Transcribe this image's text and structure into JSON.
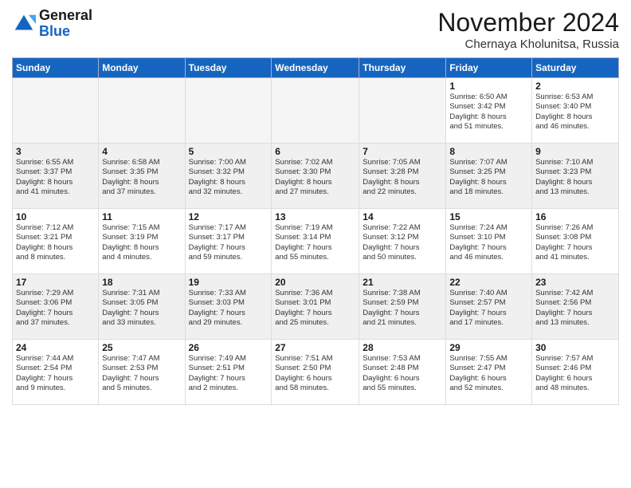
{
  "header": {
    "logo_general": "General",
    "logo_blue": "Blue",
    "month_title": "November 2024",
    "location": "Chernaya Kholunitsa, Russia"
  },
  "days_of_week": [
    "Sunday",
    "Monday",
    "Tuesday",
    "Wednesday",
    "Thursday",
    "Friday",
    "Saturday"
  ],
  "weeks": [
    [
      {
        "day": "",
        "info": ""
      },
      {
        "day": "",
        "info": ""
      },
      {
        "day": "",
        "info": ""
      },
      {
        "day": "",
        "info": ""
      },
      {
        "day": "",
        "info": ""
      },
      {
        "day": "1",
        "info": "Sunrise: 6:50 AM\nSunset: 3:42 PM\nDaylight: 8 hours\nand 51 minutes."
      },
      {
        "day": "2",
        "info": "Sunrise: 6:53 AM\nSunset: 3:40 PM\nDaylight: 8 hours\nand 46 minutes."
      }
    ],
    [
      {
        "day": "3",
        "info": "Sunrise: 6:55 AM\nSunset: 3:37 PM\nDaylight: 8 hours\nand 41 minutes."
      },
      {
        "day": "4",
        "info": "Sunrise: 6:58 AM\nSunset: 3:35 PM\nDaylight: 8 hours\nand 37 minutes."
      },
      {
        "day": "5",
        "info": "Sunrise: 7:00 AM\nSunset: 3:32 PM\nDaylight: 8 hours\nand 32 minutes."
      },
      {
        "day": "6",
        "info": "Sunrise: 7:02 AM\nSunset: 3:30 PM\nDaylight: 8 hours\nand 27 minutes."
      },
      {
        "day": "7",
        "info": "Sunrise: 7:05 AM\nSunset: 3:28 PM\nDaylight: 8 hours\nand 22 minutes."
      },
      {
        "day": "8",
        "info": "Sunrise: 7:07 AM\nSunset: 3:25 PM\nDaylight: 8 hours\nand 18 minutes."
      },
      {
        "day": "9",
        "info": "Sunrise: 7:10 AM\nSunset: 3:23 PM\nDaylight: 8 hours\nand 13 minutes."
      }
    ],
    [
      {
        "day": "10",
        "info": "Sunrise: 7:12 AM\nSunset: 3:21 PM\nDaylight: 8 hours\nand 8 minutes."
      },
      {
        "day": "11",
        "info": "Sunrise: 7:15 AM\nSunset: 3:19 PM\nDaylight: 8 hours\nand 4 minutes."
      },
      {
        "day": "12",
        "info": "Sunrise: 7:17 AM\nSunset: 3:17 PM\nDaylight: 7 hours\nand 59 minutes."
      },
      {
        "day": "13",
        "info": "Sunrise: 7:19 AM\nSunset: 3:14 PM\nDaylight: 7 hours\nand 55 minutes."
      },
      {
        "day": "14",
        "info": "Sunrise: 7:22 AM\nSunset: 3:12 PM\nDaylight: 7 hours\nand 50 minutes."
      },
      {
        "day": "15",
        "info": "Sunrise: 7:24 AM\nSunset: 3:10 PM\nDaylight: 7 hours\nand 46 minutes."
      },
      {
        "day": "16",
        "info": "Sunrise: 7:26 AM\nSunset: 3:08 PM\nDaylight: 7 hours\nand 41 minutes."
      }
    ],
    [
      {
        "day": "17",
        "info": "Sunrise: 7:29 AM\nSunset: 3:06 PM\nDaylight: 7 hours\nand 37 minutes."
      },
      {
        "day": "18",
        "info": "Sunrise: 7:31 AM\nSunset: 3:05 PM\nDaylight: 7 hours\nand 33 minutes."
      },
      {
        "day": "19",
        "info": "Sunrise: 7:33 AM\nSunset: 3:03 PM\nDaylight: 7 hours\nand 29 minutes."
      },
      {
        "day": "20",
        "info": "Sunrise: 7:36 AM\nSunset: 3:01 PM\nDaylight: 7 hours\nand 25 minutes."
      },
      {
        "day": "21",
        "info": "Sunrise: 7:38 AM\nSunset: 2:59 PM\nDaylight: 7 hours\nand 21 minutes."
      },
      {
        "day": "22",
        "info": "Sunrise: 7:40 AM\nSunset: 2:57 PM\nDaylight: 7 hours\nand 17 minutes."
      },
      {
        "day": "23",
        "info": "Sunrise: 7:42 AM\nSunset: 2:56 PM\nDaylight: 7 hours\nand 13 minutes."
      }
    ],
    [
      {
        "day": "24",
        "info": "Sunrise: 7:44 AM\nSunset: 2:54 PM\nDaylight: 7 hours\nand 9 minutes."
      },
      {
        "day": "25",
        "info": "Sunrise: 7:47 AM\nSunset: 2:53 PM\nDaylight: 7 hours\nand 5 minutes."
      },
      {
        "day": "26",
        "info": "Sunrise: 7:49 AM\nSunset: 2:51 PM\nDaylight: 7 hours\nand 2 minutes."
      },
      {
        "day": "27",
        "info": "Sunrise: 7:51 AM\nSunset: 2:50 PM\nDaylight: 6 hours\nand 58 minutes."
      },
      {
        "day": "28",
        "info": "Sunrise: 7:53 AM\nSunset: 2:48 PM\nDaylight: 6 hours\nand 55 minutes."
      },
      {
        "day": "29",
        "info": "Sunrise: 7:55 AM\nSunset: 2:47 PM\nDaylight: 6 hours\nand 52 minutes."
      },
      {
        "day": "30",
        "info": "Sunrise: 7:57 AM\nSunset: 2:46 PM\nDaylight: 6 hours\nand 48 minutes."
      }
    ]
  ]
}
